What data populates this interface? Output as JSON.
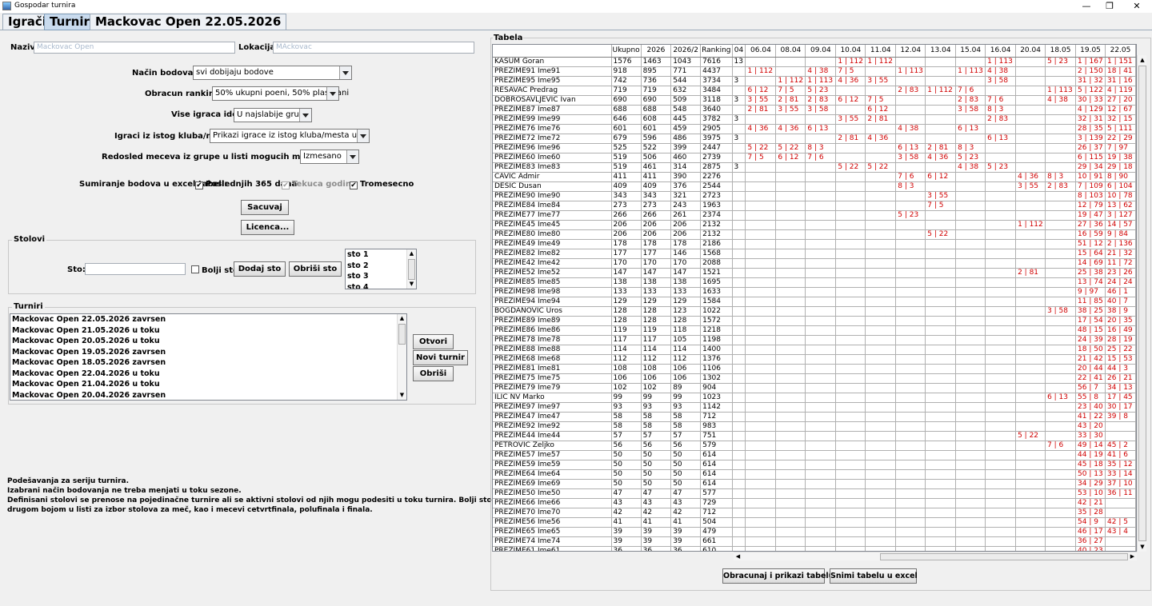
{
  "window": {
    "title": "Gospodar turnira",
    "minimize": "—",
    "maximize": "❐",
    "close": "✕"
  },
  "tabs": [
    "Igrači",
    "Turniri",
    "Mackovac Open 22.05.2026"
  ],
  "form": {
    "naziv_label": "Naziv:",
    "naziv_value": "Mackovac Open",
    "lokacija_label": "Lokacija:",
    "lokacija_value": "MAckovac",
    "nacin_label": "Način bodovanja:",
    "nacin_value": "svi dobijaju bodove",
    "obracun_label": "Obracun rankinga:",
    "obracun_value": "50% ukupni poeni, 50% plasmani",
    "vise_label": "Vise igraca ide u:",
    "vise_value": "U najslabije grupe",
    "klub_label": "Igraci iz istog kluba/mesta:",
    "klub_value": "Prikazi igrace iz istog kluba/mesta u grupi",
    "redosled_label": "Redosled meceva iz grupe u listi mogucih meceva:",
    "redosled_value": "Izmesano",
    "sumiranje_label": "Sumiranje bodova u excel tabeli:",
    "chk1": "Poslednjih 365 dana",
    "chk2": "Tekuca godina",
    "chk3": "Tromesecno",
    "check_mark": "✔",
    "sacuvaj": "Sacuvaj",
    "licenca": "Licenca..."
  },
  "stolovi": {
    "title": "Stolovi",
    "sto_label": "Sto:",
    "bolji_sto": "Bolji sto",
    "dodaj": "Dodaj sto",
    "obrisi": "Obriši sto",
    "items": [
      "sto 1",
      "sto 2",
      "sto 3",
      "sto 4"
    ]
  },
  "turniri": {
    "title": "Turniri",
    "items": [
      "Mackovac Open 22.05.2026 zavrsen",
      "Mackovac Open 21.05.2026 u toku",
      "Mackovac Open 20.05.2026 u toku",
      "Mackovac Open 19.05.2026 zavrsen",
      "Mackovac Open 18.05.2026 zavrsen",
      "Mackovac Open 22.04.2026 u toku",
      "Mackovac Open 21.04.2026 u toku",
      "Mackovac Open 20.04.2026 zavrsen"
    ],
    "otvori": "Otvori",
    "novi": "Novi turnir",
    "obrisi": "Obriši"
  },
  "info": [
    "Podešavanja za seriju turnira.",
    "Izabrani način bodovanja ne treba menjati u toku sezone.",
    "Definisani stolovi se prenose na pojedinačne turnire ali se aktivni stolovi od njih mogu podesiti u toku turnira. Bolji sto biće obojen",
    "drugom bojom u listi za izbor stolova za meč, kao i mecevi cetvrtfinala, polufinala i finala."
  ],
  "scroll": {
    "up": "▲",
    "down": "▼",
    "left": "◀",
    "right": "▶"
  },
  "tabela": {
    "title": "Tabela",
    "headers": [
      "",
      "Ukupno",
      "2026",
      "2026/2",
      "Ranking",
      "04",
      "06.04",
      "08.04",
      "09.04",
      "10.04",
      "11.04",
      "12.04",
      "13.04",
      "15.04",
      "16.04",
      "20.04",
      "18.05",
      "19.05",
      "22.05"
    ],
    "rows": [
      [
        "KASUM Goran",
        "1576",
        "1463",
        "1043",
        "7616",
        "13",
        "",
        "",
        "",
        "1 | 112",
        "1 | 112",
        "",
        "",
        "",
        "1 | 113",
        "",
        "5 | 23",
        "1 | 167",
        "1 | 151"
      ],
      [
        "PREZIME91 Ime91",
        "918",
        "895",
        "771",
        "4437",
        "",
        "1 | 112",
        "",
        "4 | 38",
        "7 | 5",
        "",
        "1 | 113",
        "",
        "1 | 113",
        "4 | 38",
        "",
        "",
        "2 | 150",
        "18 | 41"
      ],
      [
        "PREZIME95 Ime95",
        "742",
        "736",
        "544",
        "3734",
        "3",
        "",
        "1 | 112",
        "1 | 113",
        "4 | 36",
        "3 | 55",
        "",
        "",
        "",
        "3 | 58",
        "",
        "",
        "31 | 32",
        "31 | 16"
      ],
      [
        "RESAVAC Predrag",
        "719",
        "719",
        "632",
        "3484",
        "",
        "6 | 12",
        "7 | 5",
        "5 | 23",
        "",
        "",
        "2 | 83",
        "1 | 112",
        "7 | 6",
        "",
        "",
        "1 | 113",
        "5 | 122",
        "4 | 119"
      ],
      [
        "DOBROSAVLJEVIC Ivan",
        "690",
        "690",
        "509",
        "3118",
        "3",
        "3 | 55",
        "2 | 81",
        "2 | 83",
        "6 | 12",
        "7 | 5",
        "",
        "",
        "2 | 83",
        "7 | 6",
        "",
        "4 | 38",
        "30 | 33",
        "27 | 20"
      ],
      [
        "PREZIME87 Ime87",
        "688",
        "688",
        "548",
        "3640",
        "",
        "2 | 81",
        "3 | 55",
        "3 | 58",
        "",
        "6 | 12",
        "",
        "",
        "3 | 58",
        "8 | 3",
        "",
        "",
        "4 | 129",
        "12 | 67"
      ],
      [
        "PREZIME99 Ime99",
        "646",
        "608",
        "445",
        "3782",
        "3",
        "",
        "",
        "",
        "3 | 55",
        "2 | 81",
        "",
        "",
        "",
        "2 | 83",
        "",
        "",
        "32 | 31",
        "32 | 15"
      ],
      [
        "PREZIME76 Ime76",
        "601",
        "601",
        "459",
        "2905",
        "",
        "4 | 36",
        "4 | 36",
        "6 | 13",
        "",
        "",
        "4 | 38",
        "",
        "6 | 13",
        "",
        "",
        "",
        "28 | 35",
        "5 | 111"
      ],
      [
        "PREZIME72 Ime72",
        "679",
        "596",
        "486",
        "3975",
        "3",
        "",
        "",
        "",
        "2 | 81",
        "4 | 36",
        "",
        "",
        "",
        "6 | 13",
        "",
        "",
        "3 | 139",
        "22 | 29"
      ],
      [
        "PREZIME96 Ime96",
        "525",
        "522",
        "399",
        "2447",
        "",
        "5 | 22",
        "5 | 22",
        "8 | 3",
        "",
        "",
        "6 | 13",
        "2 | 81",
        "8 | 3",
        "",
        "",
        "",
        "26 | 37",
        "7 | 97"
      ],
      [
        "PREZIME60 Ime60",
        "519",
        "506",
        "460",
        "2739",
        "",
        "7 | 5",
        "6 | 12",
        "7 | 6",
        "",
        "",
        "3 | 58",
        "4 | 36",
        "5 | 23",
        "",
        "",
        "",
        "6 | 115",
        "19 | 38"
      ],
      [
        "PREZIME83 Ime83",
        "519",
        "461",
        "314",
        "2875",
        "3",
        "",
        "",
        "",
        "5 | 22",
        "5 | 22",
        "",
        "",
        "4 | 38",
        "5 | 23",
        "",
        "",
        "29 | 34",
        "29 | 18"
      ],
      [
        "CAVIC Admir",
        "411",
        "411",
        "390",
        "2276",
        "",
        "",
        "",
        "",
        "",
        "",
        "7 | 6",
        "6 | 12",
        "",
        "",
        "4 | 36",
        "8 | 3",
        "10 | 91",
        "8 | 90"
      ],
      [
        "DESIC Dusan",
        "409",
        "409",
        "376",
        "2544",
        "",
        "",
        "",
        "",
        "",
        "",
        "8 | 3",
        "",
        "",
        "",
        "3 | 55",
        "2 | 83",
        "7 | 109",
        "6 | 104"
      ],
      [
        "PREZIME90 Ime90",
        "343",
        "343",
        "321",
        "2723",
        "",
        "",
        "",
        "",
        "",
        "",
        "",
        "3 | 55",
        "",
        "",
        "",
        "",
        "8 | 103",
        "10 | 78"
      ],
      [
        "PREZIME84 Ime84",
        "273",
        "273",
        "243",
        "1963",
        "",
        "",
        "",
        "",
        "",
        "",
        "",
        "7 | 5",
        "",
        "",
        "",
        "",
        "12 | 79",
        "13 | 62"
      ],
      [
        "PREZIME77 Ime77",
        "266",
        "266",
        "261",
        "2374",
        "",
        "",
        "",
        "",
        "",
        "",
        "5 | 23",
        "",
        "",
        "",
        "",
        "",
        "19 | 47",
        "3 | 127"
      ],
      [
        "PREZIME45 Ime45",
        "206",
        "206",
        "206",
        "2132",
        "",
        "",
        "",
        "",
        "",
        "",
        "",
        "",
        "",
        "",
        "1 | 112",
        "",
        "27 | 36",
        "14 | 57"
      ],
      [
        "PREZIME80 Ime80",
        "206",
        "206",
        "206",
        "2132",
        "",
        "",
        "",
        "",
        "",
        "",
        "",
        "5 | 22",
        "",
        "",
        "",
        "",
        "16 | 59",
        "9 | 84"
      ],
      [
        "PREZIME49 Ime49",
        "178",
        "178",
        "178",
        "2186",
        "",
        "",
        "",
        "",
        "",
        "",
        "",
        "",
        "",
        "",
        "",
        "",
        "51 | 12",
        "2 | 136"
      ],
      [
        "PREZIME82 Ime82",
        "177",
        "177",
        "146",
        "1568",
        "",
        "",
        "",
        "",
        "",
        "",
        "",
        "",
        "",
        "",
        "",
        "",
        "15 | 64",
        "21 | 32"
      ],
      [
        "PREZIME42 Ime42",
        "170",
        "170",
        "170",
        "2088",
        "",
        "",
        "",
        "",
        "",
        "",
        "",
        "",
        "",
        "",
        "",
        "",
        "14 | 69",
        "11 | 72"
      ],
      [
        "PREZIME52 Ime52",
        "147",
        "147",
        "147",
        "1521",
        "",
        "",
        "",
        "",
        "",
        "",
        "",
        "",
        "",
        "",
        "2 | 81",
        "",
        "25 | 38",
        "23 | 26"
      ],
      [
        "PREZIME85 Ime85",
        "138",
        "138",
        "138",
        "1695",
        "",
        "",
        "",
        "",
        "",
        "",
        "",
        "",
        "",
        "",
        "",
        "",
        "13 | 74",
        "24 | 24"
      ],
      [
        "PREZIME98 Ime98",
        "133",
        "133",
        "133",
        "1633",
        "",
        "",
        "",
        "",
        "",
        "",
        "",
        "",
        "",
        "",
        "",
        "",
        "9 | 97",
        "46 | 1"
      ],
      [
        "PREZIME94 Ime94",
        "129",
        "129",
        "129",
        "1584",
        "",
        "",
        "",
        "",
        "",
        "",
        "",
        "",
        "",
        "",
        "",
        "",
        "11 | 85",
        "40 | 7"
      ],
      [
        "BOGDANOVIC Uros",
        "128",
        "128",
        "123",
        "1022",
        "",
        "",
        "",
        "",
        "",
        "",
        "",
        "",
        "",
        "",
        "",
        "3 | 58",
        "38 | 25",
        "38 | 9"
      ],
      [
        "PREZIME89 Ime89",
        "128",
        "128",
        "128",
        "1572",
        "",
        "",
        "",
        "",
        "",
        "",
        "",
        "",
        "",
        "",
        "",
        "",
        "17 | 54",
        "20 | 35"
      ],
      [
        "PREZIME86 Ime86",
        "119",
        "119",
        "118",
        "1218",
        "",
        "",
        "",
        "",
        "",
        "",
        "",
        "",
        "",
        "",
        "",
        "",
        "48 | 15",
        "16 | 49"
      ],
      [
        "PREZIME78 Ime78",
        "117",
        "117",
        "105",
        "1198",
        "",
        "",
        "",
        "",
        "",
        "",
        "",
        "",
        "",
        "",
        "",
        "",
        "24 | 39",
        "28 | 19"
      ],
      [
        "PREZIME88 Ime88",
        "114",
        "114",
        "114",
        "1400",
        "",
        "",
        "",
        "",
        "",
        "",
        "",
        "",
        "",
        "",
        "",
        "",
        "18 | 50",
        "25 | 22"
      ],
      [
        "PREZIME68 Ime68",
        "112",
        "112",
        "112",
        "1376",
        "",
        "",
        "",
        "",
        "",
        "",
        "",
        "",
        "",
        "",
        "",
        "",
        "21 | 42",
        "15 | 53"
      ],
      [
        "PREZIME81 Ime81",
        "108",
        "108",
        "106",
        "1106",
        "",
        "",
        "",
        "",
        "",
        "",
        "",
        "",
        "",
        "",
        "",
        "",
        "20 | 44",
        "44 | 3"
      ],
      [
        "PREZIME75 Ime75",
        "106",
        "106",
        "106",
        "1302",
        "",
        "",
        "",
        "",
        "",
        "",
        "",
        "",
        "",
        "",
        "",
        "",
        "22 | 41",
        "26 | 21"
      ],
      [
        "PREZIME79 Ime79",
        "102",
        "102",
        "89",
        "904",
        "",
        "",
        "",
        "",
        "",
        "",
        "",
        "",
        "",
        "",
        "",
        "",
        "56 | 7",
        "34 | 13"
      ],
      [
        "ILIC NV Marko",
        "99",
        "99",
        "99",
        "1023",
        "",
        "",
        "",
        "",
        "",
        "",
        "",
        "",
        "",
        "",
        "",
        "6 | 13",
        "55 | 8",
        "17 | 45"
      ],
      [
        "PREZIME97 Ime97",
        "93",
        "93",
        "93",
        "1142",
        "",
        "",
        "",
        "",
        "",
        "",
        "",
        "",
        "",
        "",
        "",
        "",
        "23 | 40",
        "30 | 17"
      ],
      [
        "PREZIME47 Ime47",
        "58",
        "58",
        "58",
        "712",
        "",
        "",
        "",
        "",
        "",
        "",
        "",
        "",
        "",
        "",
        "",
        "",
        "41 | 22",
        "39 | 8"
      ],
      [
        "PREZIME92 Ime92",
        "58",
        "58",
        "58",
        "983",
        "",
        "",
        "",
        "",
        "",
        "",
        "",
        "",
        "",
        "",
        "",
        "",
        "43 | 20",
        ""
      ],
      [
        "PREZIME44 Ime44",
        "57",
        "57",
        "57",
        "751",
        "",
        "",
        "",
        "",
        "",
        "",
        "",
        "",
        "",
        "",
        "5 | 22",
        "",
        "33 | 30",
        ""
      ],
      [
        "PETROVIC Zeljko",
        "56",
        "56",
        "56",
        "579",
        "",
        "",
        "",
        "",
        "",
        "",
        "",
        "",
        "",
        "",
        "",
        "7 | 6",
        "49 | 14",
        "45 | 2"
      ],
      [
        "PREZIME57 Ime57",
        "50",
        "50",
        "50",
        "614",
        "",
        "",
        "",
        "",
        "",
        "",
        "",
        "",
        "",
        "",
        "",
        "",
        "44 | 19",
        "41 | 6"
      ],
      [
        "PREZIME59 Ime59",
        "50",
        "50",
        "50",
        "614",
        "",
        "",
        "",
        "",
        "",
        "",
        "",
        "",
        "",
        "",
        "",
        "",
        "45 | 18",
        "35 | 12"
      ],
      [
        "PREZIME64 Ime64",
        "50",
        "50",
        "50",
        "614",
        "",
        "",
        "",
        "",
        "",
        "",
        "",
        "",
        "",
        "",
        "",
        "",
        "50 | 13",
        "33 | 14"
      ],
      [
        "PREZIME69 Ime69",
        "50",
        "50",
        "50",
        "614",
        "",
        "",
        "",
        "",
        "",
        "",
        "",
        "",
        "",
        "",
        "",
        "",
        "34 | 29",
        "37 | 10"
      ],
      [
        "PREZIME50 Ime50",
        "47",
        "47",
        "47",
        "577",
        "",
        "",
        "",
        "",
        "",
        "",
        "",
        "",
        "",
        "",
        "",
        "",
        "53 | 10",
        "36 | 11"
      ],
      [
        "PREZIME66 Ime66",
        "43",
        "43",
        "43",
        "729",
        "",
        "",
        "",
        "",
        "",
        "",
        "",
        "",
        "",
        "",
        "",
        "",
        "42 | 21",
        ""
      ],
      [
        "PREZIME70 Ime70",
        "42",
        "42",
        "42",
        "712",
        "",
        "",
        "",
        "",
        "",
        "",
        "",
        "",
        "",
        "",
        "",
        "",
        "35 | 28",
        ""
      ],
      [
        "PREZIME56 Ime56",
        "41",
        "41",
        "41",
        "504",
        "",
        "",
        "",
        "",
        "",
        "",
        "",
        "",
        "",
        "",
        "",
        "",
        "54 | 9",
        "42 | 5"
      ],
      [
        "PREZIME65 Ime65",
        "39",
        "39",
        "39",
        "479",
        "",
        "",
        "",
        "",
        "",
        "",
        "",
        "",
        "",
        "",
        "",
        "",
        "46 | 17",
        "43 | 4"
      ],
      [
        "PREZIME74 Ime74",
        "39",
        "39",
        "39",
        "661",
        "",
        "",
        "",
        "",
        "",
        "",
        "",
        "",
        "",
        "",
        "",
        "",
        "36 | 27",
        ""
      ],
      [
        "PREZIME61 Ime61",
        "36",
        "36",
        "36",
        "610",
        "",
        "",
        "",
        "",
        "",
        "",
        "",
        "",
        "",
        "",
        "",
        "",
        "40 | 23",
        ""
      ]
    ],
    "btn_obracunaj": "Obracunaj i prikazi tabelu",
    "btn_snimi": "Snimi tabelu u excel"
  }
}
